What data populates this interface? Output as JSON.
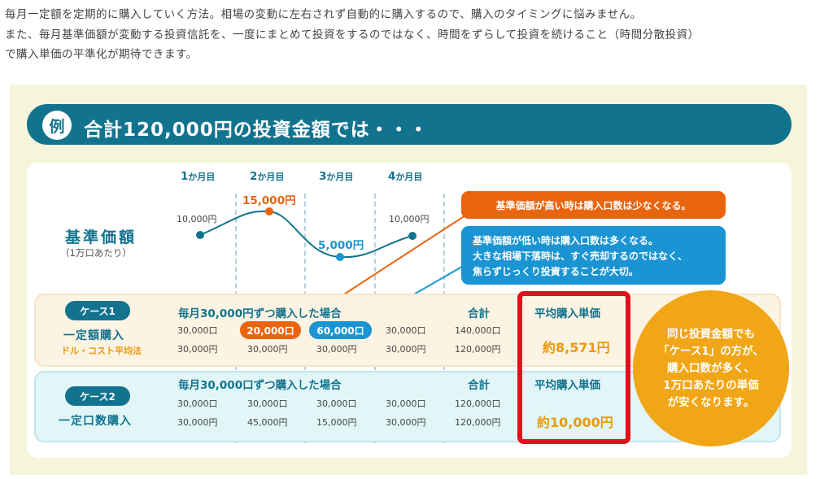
{
  "intro": {
    "line1": "毎月一定額を定期的に購入していく方法。相場の変動に左右されず自動的に購入するので、購入のタイミングに悩みません。",
    "line2": "また、毎月基準価額が変動する投資信託を、一度にまとめて投資をするのではなく、時間をずらして投資を続けること（時間分散投資）",
    "line3": "で購入単価の平準化が期待できます。"
  },
  "banner": {
    "badge": "例",
    "title": "合計120,000円の投資金額では・・・"
  },
  "months": [
    {
      "num": "1",
      "suffix": "か月目"
    },
    {
      "num": "2",
      "suffix": "か月目"
    },
    {
      "num": "3",
      "suffix": "か月目"
    },
    {
      "num": "4",
      "suffix": "か月目"
    }
  ],
  "price_label": {
    "title": "基準価額",
    "sub": "（1万口あたり）"
  },
  "prices": [
    "10,000円",
    "15,000円",
    "5,000円",
    "10,000円"
  ],
  "callouts": {
    "high": "基準価額が高い時は購入口数は少なくなる。",
    "low": [
      "基準価額が低い時は購入口数は多くなる。",
      "大きな相場下落時は、すぐ売却するのではなく、",
      "焦らずじっくり投資することが大切。"
    ]
  },
  "case1": {
    "pill": "ケース1",
    "name": "一定額購入",
    "sub": "ドル・コスト平均法",
    "header": "毎月30,000円ずつ購入した場合",
    "units": [
      "30,000口",
      "20,000口",
      "60,000口",
      "30,000口"
    ],
    "amounts": [
      "30,000円",
      "30,000円",
      "30,000円",
      "30,000円"
    ],
    "total_label": "合計",
    "total_units": "140,000口",
    "total_amount": "120,000円",
    "avg_label": "平均購入単価",
    "avg_value": "約8,571円"
  },
  "case2": {
    "pill": "ケース2",
    "name": "一定口数購入",
    "header": "毎月30,000口ずつ購入した場合",
    "units": [
      "30,000口",
      "30,000口",
      "30,000口",
      "30,000口"
    ],
    "amounts": [
      "30,000円",
      "45,000円",
      "15,000円",
      "30,000円"
    ],
    "total_label": "合計",
    "total_units": "120,000口",
    "total_amount": "120,000円",
    "avg_label": "平均購入単価",
    "avg_value": "約10,000円"
  },
  "bubble": [
    "同じ投資金額でも",
    "「ケース1」の方が、",
    "購入口数が多く、",
    "1万口あたりの単価",
    "が安くなります。"
  ],
  "colors": {
    "teal": "#12738f",
    "orange": "#e8640e",
    "blue": "#1a94d2",
    "amber": "#f0a616",
    "red": "#e0111b"
  }
}
